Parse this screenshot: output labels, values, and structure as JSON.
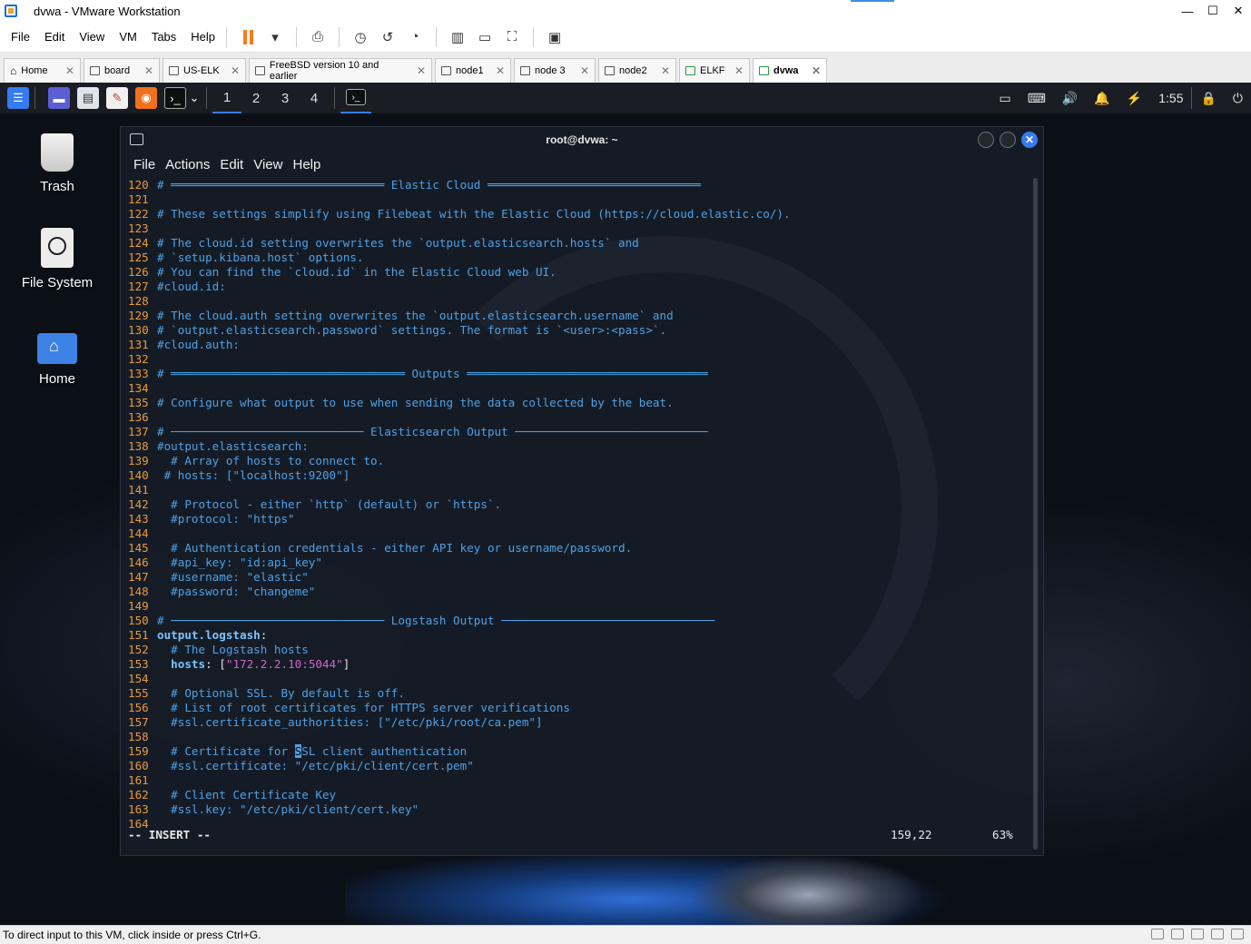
{
  "window": {
    "title": "dvwa - VMware Workstation",
    "min": "—",
    "max": "☐",
    "close": "✕"
  },
  "menubar": {
    "items": [
      "File",
      "Edit",
      "View",
      "VM",
      "Tabs",
      "Help"
    ]
  },
  "tabs": [
    {
      "label": "Home"
    },
    {
      "label": "board"
    },
    {
      "label": "US-ELK"
    },
    {
      "label": "FreeBSD version 10 and earlier"
    },
    {
      "label": "node1"
    },
    {
      "label": "node 3"
    },
    {
      "label": "node2"
    },
    {
      "label": "ELKF"
    },
    {
      "label": "dvwa"
    }
  ],
  "kali_panel": {
    "workspaces": [
      "1",
      "2",
      "3",
      "4"
    ],
    "clock": "1:55"
  },
  "desktop": {
    "icons": [
      {
        "label": "Trash"
      },
      {
        "label": "File System"
      },
      {
        "label": "Home"
      }
    ]
  },
  "terminal": {
    "title": "root@dvwa: ~",
    "menu": [
      "File",
      "Actions",
      "Edit",
      "View",
      "Help"
    ],
    "lines": [
      {
        "n": "120",
        "t": "# ═══════════════════════════════ Elastic Cloud ═══════════════════════════════",
        "c": "cm"
      },
      {
        "n": "121",
        "t": "",
        "c": "cm"
      },
      {
        "n": "122",
        "t": "# These settings simplify using Filebeat with the Elastic Cloud (https://cloud.elastic.co/).",
        "c": "cm"
      },
      {
        "n": "123",
        "t": "",
        "c": "cm"
      },
      {
        "n": "124",
        "t": "# The cloud.id setting overwrites the `output.elasticsearch.hosts` and",
        "c": "cm"
      },
      {
        "n": "125",
        "t": "# `setup.kibana.host` options.",
        "c": "cm"
      },
      {
        "n": "126",
        "t": "# You can find the `cloud.id` in the Elastic Cloud web UI.",
        "c": "cm"
      },
      {
        "n": "127",
        "t": "#cloud.id:",
        "c": "cm"
      },
      {
        "n": "128",
        "t": "",
        "c": "cm"
      },
      {
        "n": "129",
        "t": "# The cloud.auth setting overwrites the `output.elasticsearch.username` and",
        "c": "cm"
      },
      {
        "n": "130",
        "t": "# `output.elasticsearch.password` settings. The format is `<user>:<pass>`.",
        "c": "cm"
      },
      {
        "n": "131",
        "t": "#cloud.auth:",
        "c": "cm"
      },
      {
        "n": "132",
        "t": "",
        "c": "cm"
      },
      {
        "n": "133",
        "t": "# ══════════════════════════════════ Outputs ═══════════════════════════════════",
        "c": "cm"
      },
      {
        "n": "134",
        "t": "",
        "c": "cm"
      },
      {
        "n": "135",
        "t": "# Configure what output to use when sending the data collected by the beat.",
        "c": "cm"
      },
      {
        "n": "136",
        "t": "",
        "c": "cm"
      },
      {
        "n": "137",
        "t": "# ──────────────────────────── Elasticsearch Output ────────────────────────────",
        "c": "cm"
      },
      {
        "n": "138",
        "t": "#output.elasticsearch:",
        "c": "cm"
      },
      {
        "n": "139",
        "t": "  # Array of hosts to connect to.",
        "c": "cm"
      },
      {
        "n": "140",
        "t": " # hosts: [\"localhost:9200\"]",
        "c": "cm"
      },
      {
        "n": "141",
        "t": "",
        "c": "cm"
      },
      {
        "n": "142",
        "t": "  # Protocol - either `http` (default) or `https`.",
        "c": "cm"
      },
      {
        "n": "143",
        "t": "  #protocol: \"https\"",
        "c": "cm"
      },
      {
        "n": "144",
        "t": "",
        "c": "cm"
      },
      {
        "n": "145",
        "t": "  # Authentication credentials - either API key or username/password.",
        "c": "cm"
      },
      {
        "n": "146",
        "t": "  #api_key: \"id:api_key\"",
        "c": "cm"
      },
      {
        "n": "147",
        "t": "  #username: \"elastic\"",
        "c": "cm"
      },
      {
        "n": "148",
        "t": "  #password: \"changeme\"",
        "c": "cm"
      },
      {
        "n": "149",
        "t": "",
        "c": "cm"
      },
      {
        "n": "150",
        "t": "# ─────────────────────────────── Logstash Output ───────────────────────────────",
        "c": "cm"
      },
      {
        "n": "151",
        "t": "output.logstash:",
        "c": "key"
      },
      {
        "n": "152",
        "t": "  # The Logstash hosts",
        "c": "cm"
      },
      {
        "n": "153",
        "t": "  hosts: [\"172.2.2.10:5044\"]",
        "c": "hosts"
      },
      {
        "n": "154",
        "t": "",
        "c": "cm"
      },
      {
        "n": "155",
        "t": "  # Optional SSL. By default is off.",
        "c": "cm"
      },
      {
        "n": "156",
        "t": "  # List of root certificates for HTTPS server verifications",
        "c": "cm"
      },
      {
        "n": "157",
        "t": "  #ssl.certificate_authorities: [\"/etc/pki/root/ca.pem\"]",
        "c": "cm"
      },
      {
        "n": "158",
        "t": "",
        "c": "cm"
      },
      {
        "n": "159",
        "t": "  # Certificate for SSL client authentication",
        "c": "cursorline"
      },
      {
        "n": "160",
        "t": "  #ssl.certificate: \"/etc/pki/client/cert.pem\"",
        "c": "cm"
      },
      {
        "n": "161",
        "t": "",
        "c": "cm"
      },
      {
        "n": "162",
        "t": "  # Client Certificate Key",
        "c": "cm"
      },
      {
        "n": "163",
        "t": "  #ssl.key: \"/etc/pki/client/cert.key\"",
        "c": "cm"
      },
      {
        "n": "164",
        "t": "",
        "c": "cm"
      }
    ],
    "status_mode": "-- INSERT --",
    "status_pos": "159,22",
    "status_pct": "63%"
  },
  "statusbar": {
    "message": "To direct input to this VM, click inside or press Ctrl+G."
  },
  "colors": {
    "line_number": "#e89a3c",
    "comment": "#4ea1e6",
    "string": "#d065c9",
    "accent": "#367bf0"
  }
}
